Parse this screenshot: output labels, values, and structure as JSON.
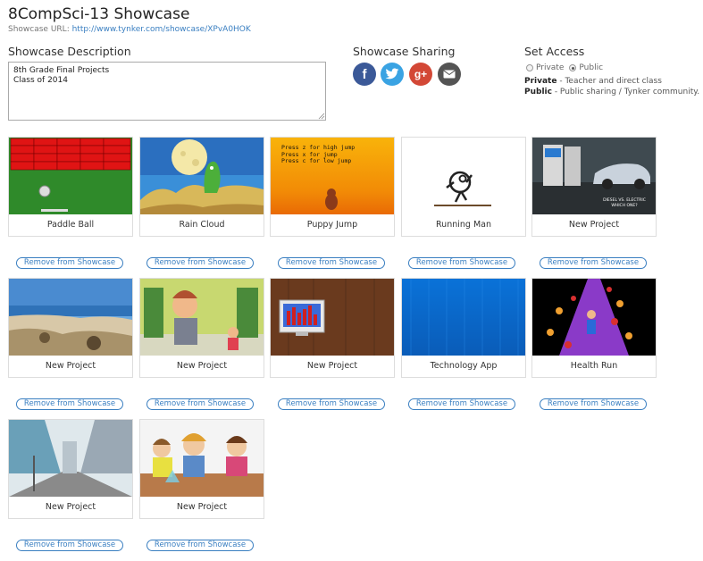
{
  "header": {
    "title": "8CompSci-13 Showcase",
    "url_label": "Showcase URL: ",
    "url": "http://www.tynker.com/showcase/XPvA0HOK"
  },
  "description": {
    "label": "Showcase Description",
    "text": "8th Grade Final Projects\nClass of 2014"
  },
  "sharing": {
    "label": "Showcase Sharing",
    "icons": [
      "facebook-icon",
      "twitter-icon",
      "google-plus-icon",
      "email-icon"
    ],
    "fb_glyph": "f",
    "gp_glyph": "g+"
  },
  "access": {
    "label": "Set Access",
    "private_label": "Private",
    "public_label": "Public",
    "selected": "Public",
    "private_term": "Private",
    "private_desc": " - Teacher and direct class",
    "public_term": "Public",
    "public_desc": " - Public sharing / Tynker community."
  },
  "remove_label": "Remove from Showcase",
  "projects": [
    {
      "title": "Paddle Ball"
    },
    {
      "title": "Rain Cloud"
    },
    {
      "title": "Puppy Jump",
      "thumb_text": [
        "Press z for high jump",
        "Press x for jump",
        "Press c for low jump"
      ]
    },
    {
      "title": "Running Man"
    },
    {
      "title": "New Project",
      "thumb_text": [
        "DIESEL VS. ELECTRIC",
        "WHICH ONE?"
      ]
    },
    {
      "title": "New Project"
    },
    {
      "title": "New Project"
    },
    {
      "title": "New Project"
    },
    {
      "title": "Technology App"
    },
    {
      "title": "Health Run"
    },
    {
      "title": "New Project"
    },
    {
      "title": "New Project"
    }
  ]
}
